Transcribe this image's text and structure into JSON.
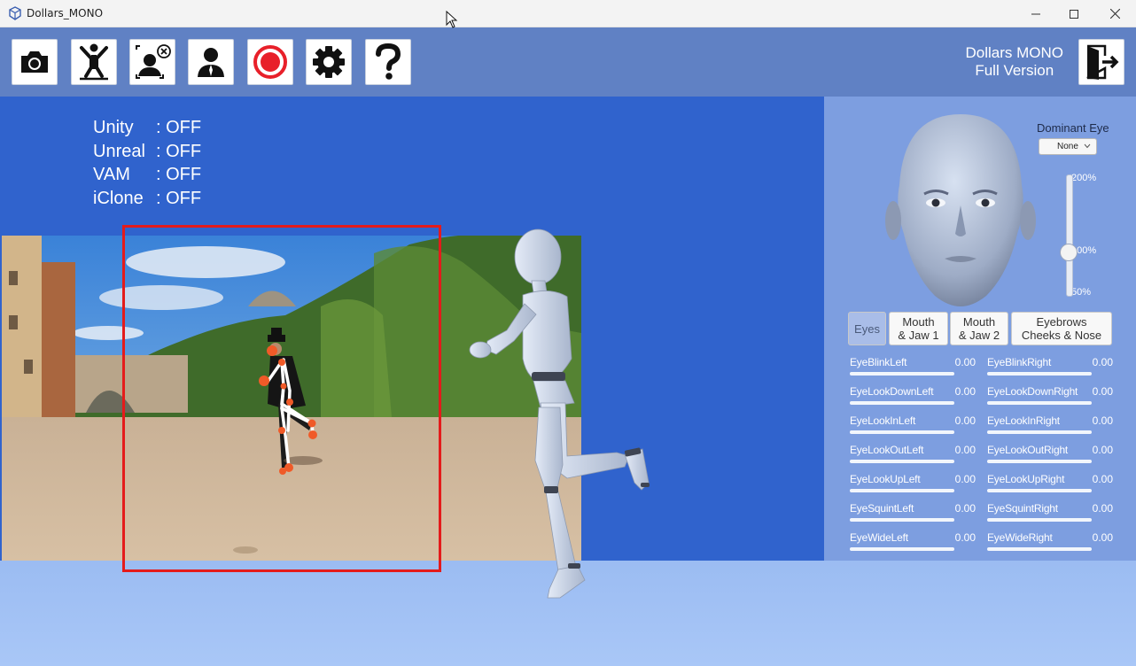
{
  "window": {
    "title": "Dollars_MONO",
    "controls": [
      "minimize-icon",
      "maximize-icon",
      "close-icon"
    ]
  },
  "toolbar": {
    "buttons": [
      {
        "name": "camera-button",
        "icon": "camera-icon"
      },
      {
        "name": "pose-calibrate-button",
        "icon": "t-pose-icon"
      },
      {
        "name": "reset-person-button",
        "icon": "person-remove-icon"
      },
      {
        "name": "avatar-button",
        "icon": "person-icon"
      },
      {
        "name": "record-button",
        "icon": "record-icon"
      },
      {
        "name": "settings-button",
        "icon": "gear-icon"
      },
      {
        "name": "help-button",
        "icon": "question-icon"
      }
    ],
    "version_line1": "Dollars MONO",
    "version_line2": "Full Version",
    "exit_icon": "exit-door-icon"
  },
  "status": [
    {
      "name": "Unity",
      "value": ": OFF"
    },
    {
      "name": "Unreal",
      "value": ": OFF"
    },
    {
      "name": "VAM",
      "value": ": OFF"
    },
    {
      "name": "iClone",
      "value": ": OFF"
    }
  ],
  "face_panel": {
    "dominant_eye_label": "Dominant Eye",
    "dominant_eye_value": "None",
    "slider_labels": {
      "max": "200%",
      "mid": "100%",
      "min": "50%"
    },
    "slider_value_percent": 100,
    "tabs": [
      {
        "label_line1": "Eyes",
        "label_line2": "",
        "active": true
      },
      {
        "label_line1": "Mouth",
        "label_line2": "& Jaw 1",
        "active": false
      },
      {
        "label_line1": "Mouth",
        "label_line2": "& Jaw 2",
        "active": false
      },
      {
        "label_line1": "Eyebrows",
        "label_line2": "Cheeks & Nose",
        "active": false
      }
    ],
    "blendshapes_left": [
      {
        "name": "EyeBlinkLeft",
        "value": "0.00"
      },
      {
        "name": "EyeLookDownLeft",
        "value": "0.00"
      },
      {
        "name": "EyeLookInLeft",
        "value": "0.00"
      },
      {
        "name": "EyeLookOutLeft",
        "value": "0.00"
      },
      {
        "name": "EyeLookUpLeft",
        "value": "0.00"
      },
      {
        "name": "EyeSquintLeft",
        "value": "0.00"
      },
      {
        "name": "EyeWideLeft",
        "value": "0.00"
      }
    ],
    "blendshapes_right": [
      {
        "name": "EyeBlinkRight",
        "value": "0.00"
      },
      {
        "name": "EyeLookDownRight",
        "value": "0.00"
      },
      {
        "name": "EyeLookInRight",
        "value": "0.00"
      },
      {
        "name": "EyeLookOutRight",
        "value": "0.00"
      },
      {
        "name": "EyeLookUpRight",
        "value": "0.00"
      },
      {
        "name": "EyeSquintRight",
        "value": "0.00"
      },
      {
        "name": "EyeWideRight",
        "value": "0.00"
      }
    ]
  },
  "colors": {
    "toolbar": "#6081c4",
    "viewport": "#3063cd",
    "panel": "#7d9ee0",
    "roi_box": "#e41b1b",
    "keypoint": "#f05a28"
  }
}
